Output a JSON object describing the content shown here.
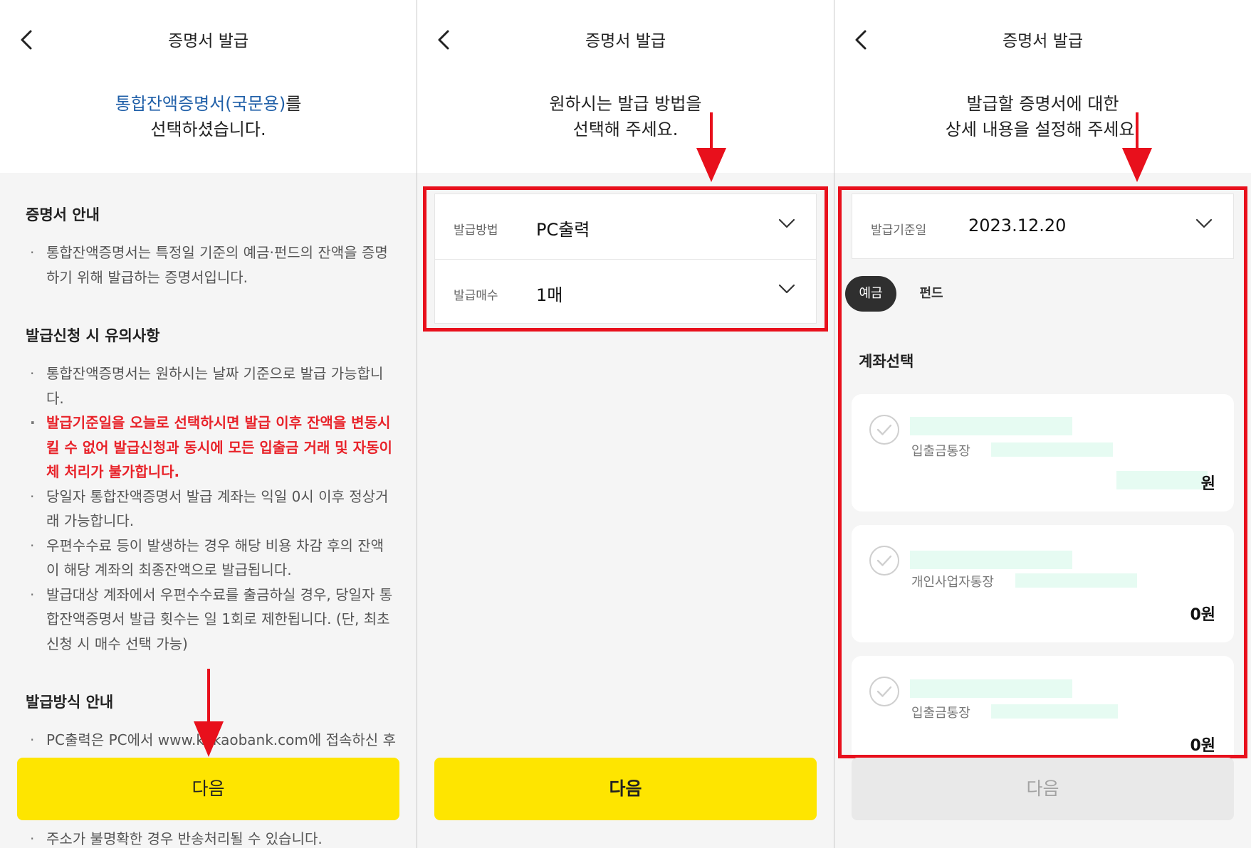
{
  "panel1": {
    "header": {
      "title": "증명서 발급"
    },
    "selected": {
      "highlight": "통합잔액증명서(국문용)",
      "suffix": "를",
      "line2": "선택하셨습니다."
    },
    "guide_title": "증명서 안내",
    "guide_items": [
      "통합잔액증명서는 특정일 기준의 예금·펀드의 잔액을 증명하기 위해 발급하는 증명서입니다."
    ],
    "notice_title": "발급신청 시 유의사항",
    "notice_items": [
      "통합잔액증명서는 원하시는 날짜 기준으로 발급 가능합니다.",
      "발급기준일을 오늘로 선택하시면 발급 이후 잔액을 변동시킬 수 없어 발급신청과 동시에 모든 입출금 거래 및 자동이체 처리가 불가합니다.",
      "당일자 통합잔액증명서 발급 계좌는 익일 0시 이후 정상거래 가능합니다.",
      "우편수수료 등이 발생하는 경우 해당 비용 차감 후의 잔액이 해당 계좌의 최종잔액으로 발급됩니다.",
      "발급대상 계좌에서 우편수수료를 출금하실 경우, 당일자 통합잔액증명서 발급 횟수는 일 1회로 제한됩니다. (단, 최초 신청 시 매수 선택 가능)"
    ],
    "method_title": "발급방식 안내",
    "method_items": [
      "PC출력은 PC에서 www.kakaobank.com에 접속하신 후"
    ],
    "bottom_text": "주소가 불명확한 경우 반송처리될 수 있습니다.",
    "next_label": "다음"
  },
  "panel2": {
    "header": {
      "title": "증명서 발급"
    },
    "subtitle": {
      "line1": "원하시는 발급 방법을",
      "line2": "선택해 주세요."
    },
    "fields": [
      {
        "label": "발급방법",
        "value": "PC출력"
      },
      {
        "label": "발급매수",
        "value": "1매"
      }
    ],
    "next_label": "다음"
  },
  "panel3": {
    "header": {
      "title": "증명서 발급"
    },
    "subtitle": {
      "line1": "발급할 증명서에 대한",
      "line2": "상세 내용을 설정해 주세요."
    },
    "date_field": {
      "label": "발급기준일",
      "value": "2023.12.20"
    },
    "tabs": [
      "예금",
      "펀드"
    ],
    "account_title": "계좌선택",
    "accounts": [
      {
        "type": "입출금통장",
        "amount": "원"
      },
      {
        "type": "개인사업자통장",
        "amount": "0원"
      },
      {
        "type": "입출금통장",
        "amount": "0원"
      }
    ],
    "next_label": "다음"
  },
  "colors": {
    "accent_yellow": "#fee500",
    "annotation_red": "#e8101c",
    "warning_red": "#e8232a",
    "link_blue": "#1f5fa8",
    "mask_green": "#e6fbf2"
  }
}
